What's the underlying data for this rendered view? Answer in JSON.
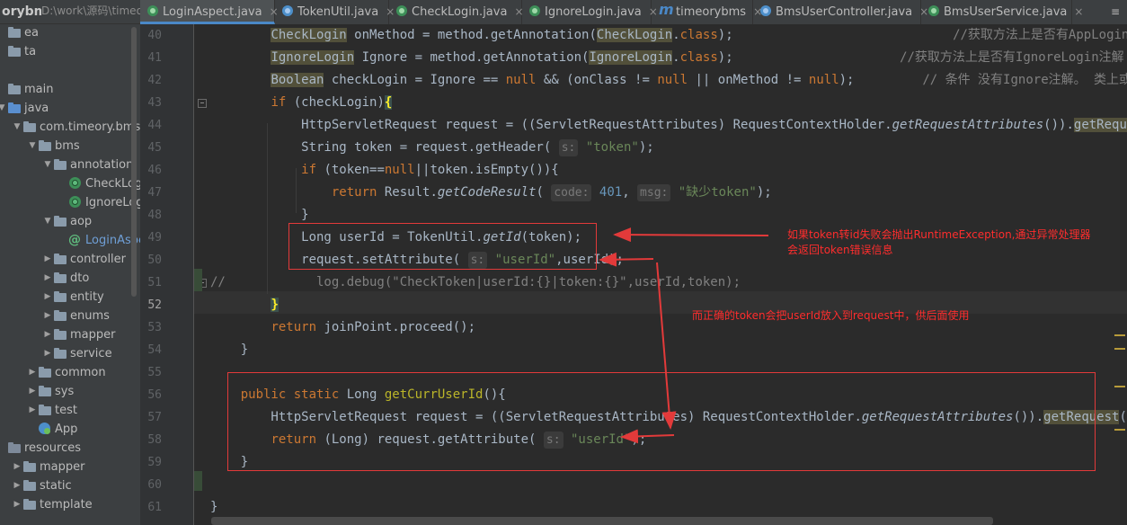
{
  "project": {
    "root_label": "orybms",
    "root_path": "D:\\work\\源码\\timeo",
    "tree": [
      {
        "label": "ea",
        "type": "folder",
        "arrow": "",
        "indent": 0
      },
      {
        "label": "ta",
        "type": "folder",
        "arrow": "",
        "indent": 0
      },
      {
        "label": "",
        "type": "none",
        "arrow": "",
        "indent": 0
      },
      {
        "label": "main",
        "type": "folder",
        "arrow": "",
        "indent": 0
      },
      {
        "label": "java",
        "type": "folder-src",
        "arrow": "▼",
        "indent": 0
      },
      {
        "label": "com.timeory.bms",
        "type": "folder",
        "arrow": "▼",
        "indent": 1
      },
      {
        "label": "bms",
        "type": "folder",
        "arrow": "▼",
        "indent": 2
      },
      {
        "label": "annotation",
        "type": "folder",
        "arrow": "▼",
        "indent": 3
      },
      {
        "label": "CheckLogin",
        "type": "annotation",
        "arrow": "",
        "indent": 4
      },
      {
        "label": "IgnoreLogin",
        "type": "annotation",
        "arrow": "",
        "indent": 4
      },
      {
        "label": "aop",
        "type": "folder",
        "arrow": "▼",
        "indent": 3
      },
      {
        "label": "LoginAspect",
        "type": "class",
        "arrow": "",
        "indent": 4,
        "selected": true
      },
      {
        "label": "controller",
        "type": "folder",
        "arrow": "▶",
        "indent": 3
      },
      {
        "label": "dto",
        "type": "folder",
        "arrow": "▶",
        "indent": 3
      },
      {
        "label": "entity",
        "type": "folder",
        "arrow": "▶",
        "indent": 3
      },
      {
        "label": "enums",
        "type": "folder",
        "arrow": "▶",
        "indent": 3
      },
      {
        "label": "mapper",
        "type": "folder",
        "arrow": "▶",
        "indent": 3
      },
      {
        "label": "service",
        "type": "folder",
        "arrow": "▶",
        "indent": 3
      },
      {
        "label": "common",
        "type": "folder",
        "arrow": "▶",
        "indent": 2
      },
      {
        "label": "sys",
        "type": "folder",
        "arrow": "▶",
        "indent": 2
      },
      {
        "label": "test",
        "type": "folder",
        "arrow": "▶",
        "indent": 2
      },
      {
        "label": "App",
        "type": "app",
        "arrow": "",
        "indent": 2
      },
      {
        "label": "resources",
        "type": "folder-res",
        "arrow": "",
        "indent": 0
      },
      {
        "label": "mapper",
        "type": "folder",
        "arrow": "▶",
        "indent": 1
      },
      {
        "label": "static",
        "type": "folder",
        "arrow": "▶",
        "indent": 1
      },
      {
        "label": "template",
        "type": "folder",
        "arrow": "▶",
        "indent": 1
      }
    ]
  },
  "tabs": [
    {
      "label": "LoginAspect.java",
      "icon": "c",
      "active": true
    },
    {
      "label": "TokenUtil.java",
      "icon": "blue",
      "active": false
    },
    {
      "label": "CheckLogin.java",
      "icon": "c",
      "active": false
    },
    {
      "label": "IgnoreLogin.java",
      "icon": "c",
      "active": false
    },
    {
      "label": "timeorybms",
      "icon": "m",
      "active": false
    },
    {
      "label": "BmsUserController.java",
      "icon": "blue",
      "active": false
    },
    {
      "label": "BmsUserService.java",
      "icon": "c",
      "active": false
    }
  ],
  "tab_close": "×",
  "tab_menu": "≡",
  "editor": {
    "line_numbers": [
      "40",
      "41",
      "42",
      "43",
      "44",
      "45",
      "46",
      "47",
      "48",
      "49",
      "50",
      "51",
      "52",
      "53",
      "54",
      "55",
      "56",
      "57",
      "58",
      "59",
      "60",
      "61"
    ],
    "current_line": "52",
    "lines": [
      [
        {
          "t": "        "
        },
        {
          "t": "CheckLogin",
          "c": "hl2"
        },
        {
          "t": " onMethod = method.getAnnotation("
        },
        {
          "t": "CheckLogin",
          "c": "hl2"
        },
        {
          "t": "."
        },
        {
          "t": "class",
          "c": "kw"
        },
        {
          "t": ");                             "
        },
        {
          "t": "//获取方法上是否有AppLogin注",
          "c": "cm"
        }
      ],
      [
        {
          "t": "        "
        },
        {
          "t": "IgnoreLogin",
          "c": "hl2"
        },
        {
          "t": " Ignore = method.getAnnotation("
        },
        {
          "t": "IgnoreLogin",
          "c": "hl2"
        },
        {
          "t": "."
        },
        {
          "t": "class",
          "c": "kw"
        },
        {
          "t": ");                      "
        },
        {
          "t": "//获取方法上是否有IgnoreLogin注解",
          "c": "cm"
        }
      ],
      [
        {
          "t": "        "
        },
        {
          "t": "Boolean",
          "c": "hl2"
        },
        {
          "t": " checkLogin = Ignore == "
        },
        {
          "t": "null",
          "c": "kw"
        },
        {
          "t": " && (onClass != "
        },
        {
          "t": "null",
          "c": "kw"
        },
        {
          "t": " || onMethod != "
        },
        {
          "t": "null",
          "c": "kw"
        },
        {
          "t": ");         "
        },
        {
          "t": "// 条件 没有Ignore注解。 类上或者",
          "c": "cm"
        }
      ],
      [
        {
          "t": "        "
        },
        {
          "t": "if",
          "c": "kw"
        },
        {
          "t": " (checkLogin)"
        },
        {
          "t": "{",
          "c": "brace-hl"
        }
      ],
      [
        {
          "t": "            HttpServletRequest request = ((ServletRequestAttributes) RequestContextHolder."
        },
        {
          "t": "getRequestAttributes",
          "c": "it"
        },
        {
          "t": "())."
        },
        {
          "t": "getRequest",
          "c": "hl2"
        },
        {
          "t": "();"
        }
      ],
      [
        {
          "t": "            String token = request.getHeader( "
        },
        {
          "t": "s:",
          "c": "hint"
        },
        {
          "t": " "
        },
        {
          "t": "\"token\"",
          "c": "str"
        },
        {
          "t": ");"
        }
      ],
      [
        {
          "t": "            "
        },
        {
          "t": "if",
          "c": "kw"
        },
        {
          "t": " (token=="
        },
        {
          "t": "null",
          "c": "kw"
        },
        {
          "t": "||token.isEmpty()){"
        }
      ],
      [
        {
          "t": "                "
        },
        {
          "t": "return",
          "c": "kw"
        },
        {
          "t": " Result."
        },
        {
          "t": "getCodeResult",
          "c": "it"
        },
        {
          "t": "( "
        },
        {
          "t": "code:",
          "c": "hint"
        },
        {
          "t": " "
        },
        {
          "t": "401",
          "c": "num"
        },
        {
          "t": ", "
        },
        {
          "t": "msg:",
          "c": "hint"
        },
        {
          "t": " "
        },
        {
          "t": "\"缺少token\"",
          "c": "str"
        },
        {
          "t": ");"
        }
      ],
      [
        {
          "t": "            }"
        }
      ],
      [
        {
          "t": "            Long userId = TokenUtil."
        },
        {
          "t": "getId",
          "c": "it"
        },
        {
          "t": "(token);"
        }
      ],
      [
        {
          "t": "            request.setAttribute( "
        },
        {
          "t": "s:",
          "c": "hint"
        },
        {
          "t": " "
        },
        {
          "t": "\"userId\"",
          "c": "str"
        },
        {
          "t": ",userId);"
        }
      ],
      [
        {
          "t": "//",
          "c": "cm"
        },
        {
          "t": "            log.debug(\"CheckToken|userId:{}|token:{}\",userId,token);",
          "c": "cm"
        }
      ],
      [
        {
          "t": "        "
        },
        {
          "t": "}",
          "c": "brace-hl"
        }
      ],
      [
        {
          "t": "        "
        },
        {
          "t": "return",
          "c": "kw"
        },
        {
          "t": " joinPoint.proceed();"
        }
      ],
      [
        {
          "t": "    }"
        }
      ],
      [
        {
          "t": ""
        }
      ],
      [
        {
          "t": "    "
        },
        {
          "t": "public static",
          "c": "kw"
        },
        {
          "t": " Long "
        },
        {
          "t": "getCurrUserId",
          "c": "ann2"
        },
        {
          "t": "(){"
        }
      ],
      [
        {
          "t": "        HttpServletRequest request = ((ServletRequestAttributes) RequestContextHolder."
        },
        {
          "t": "getRequestAttributes",
          "c": "it"
        },
        {
          "t": "())."
        },
        {
          "t": "getRequest",
          "c": "hl2"
        },
        {
          "t": "();"
        }
      ],
      [
        {
          "t": "        "
        },
        {
          "t": "return",
          "c": "kw"
        },
        {
          "t": " (Long) request.getAttribute( "
        },
        {
          "t": "s:",
          "c": "hint"
        },
        {
          "t": " "
        },
        {
          "t": "\"userId\"",
          "c": "str"
        },
        {
          "t": ");"
        }
      ],
      [
        {
          "t": "    }"
        }
      ],
      [
        {
          "t": ""
        }
      ],
      [
        {
          "t": "}"
        }
      ]
    ]
  },
  "annotations": {
    "note1_line1": "如果token转id失败会抛出RuntimeException,通过异常处理器",
    "note1_line2": "会返回token错误信息",
    "note2": "而正确的token会把userId放入到request中，供后面使用"
  },
  "colors": {
    "annotation_red": "#e23a3a",
    "accent_tab": "#4a88c7"
  }
}
